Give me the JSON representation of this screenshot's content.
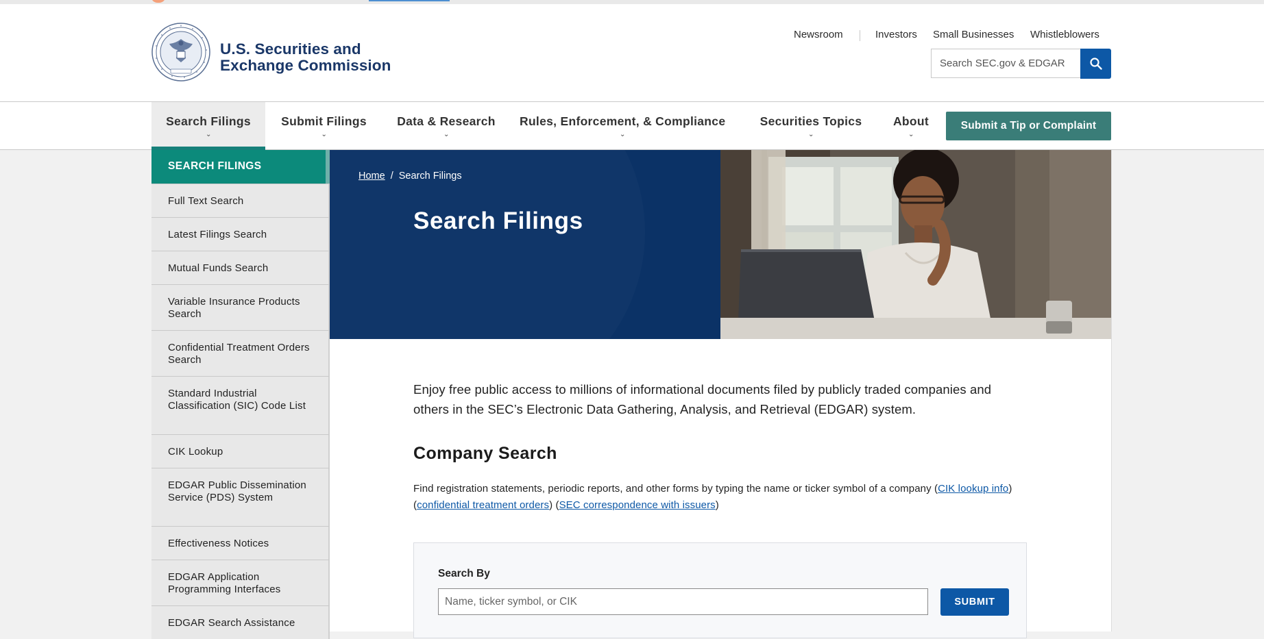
{
  "header": {
    "brand_line1": "U.S. Securities and",
    "brand_line2": "Exchange Commission",
    "utility_links": [
      "Newsroom",
      "Investors",
      "Small Businesses",
      "Whistleblowers"
    ],
    "search_placeholder": "Search SEC.gov & EDGAR"
  },
  "nav": {
    "items": [
      "Search Filings",
      "Submit Filings",
      "Data & Research",
      "Rules, Enforcement, & Compliance",
      "Securities Topics",
      "About"
    ],
    "active": "Search Filings",
    "tip_button": "Submit a Tip or Complaint"
  },
  "sidebar": {
    "heading": "SEARCH FILINGS",
    "items": [
      "Full Text Search",
      "Latest Filings Search",
      "Mutual Funds Search",
      "Variable Insurance Products Search",
      "Confidential Treatment Orders Search",
      "Standard Industrial Classification (SIC) Code List",
      "CIK Lookup",
      "EDGAR Public Dissemination Service (PDS) System",
      "Effectiveness Notices",
      "EDGAR Application Programming Interfaces",
      "EDGAR Search Assistance"
    ]
  },
  "hero": {
    "breadcrumb_home": "Home",
    "breadcrumb_sep": "/",
    "breadcrumb_current": "Search Filings",
    "title": "Search Filings"
  },
  "main": {
    "intro": "Enjoy free public access to millions of informational documents filed by publicly traded companies and others in the SEC’s Electronic Data Gathering, Analysis, and Retrieval (EDGAR) system.",
    "company_heading": "Company Search",
    "desc_text": "Find registration statements, periodic reports, and other forms by typing the name or ticker symbol of a company (",
    "link_cik": "CIK lookup info",
    "link_cto": "confidential treatment orders",
    "link_corr": "SEC correspondence with issuers",
    "form_label": "Search By",
    "input_placeholder": "Name, ticker symbol, or CIK",
    "submit_label": "SUBMIT"
  },
  "colors": {
    "brand_navy": "#1a3768",
    "teal": "#0c8a7b",
    "hero_blue": "#0b3266",
    "button_blue": "#0d58a6"
  },
  "icons": [
    "sec-seal-logo",
    "search-icon",
    "chevron-down-icon"
  ]
}
